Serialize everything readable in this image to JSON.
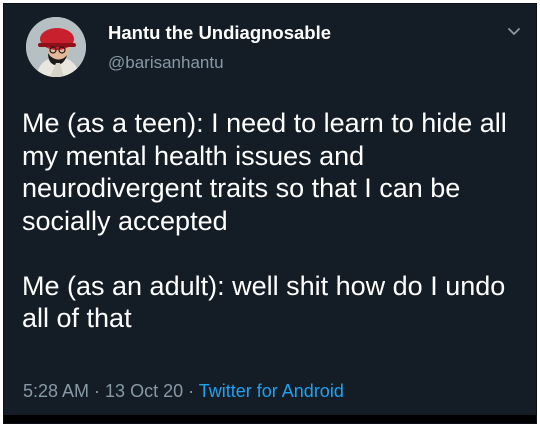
{
  "user": {
    "display_name": "Hantu the Undiagnosable",
    "handle": "@barisanhantu"
  },
  "tweet": {
    "paragraphs": [
      "Me (as a teen): I need to learn to hide all my mental health issues and neurodivergent traits so that I can be socially accepted",
      "Me (as an adult): well shit how do I undo all of that"
    ],
    "time": "5:28 AM",
    "date": "13 Oct 20",
    "separator": " · ",
    "source": "Twitter for Android"
  },
  "icons": {
    "avatar": "avatar-illustration",
    "menu": "chevron-down-icon"
  },
  "colors": {
    "background": "#141d26",
    "text": "#ffffff",
    "muted": "#8899a6",
    "link": "#1da1f2"
  }
}
